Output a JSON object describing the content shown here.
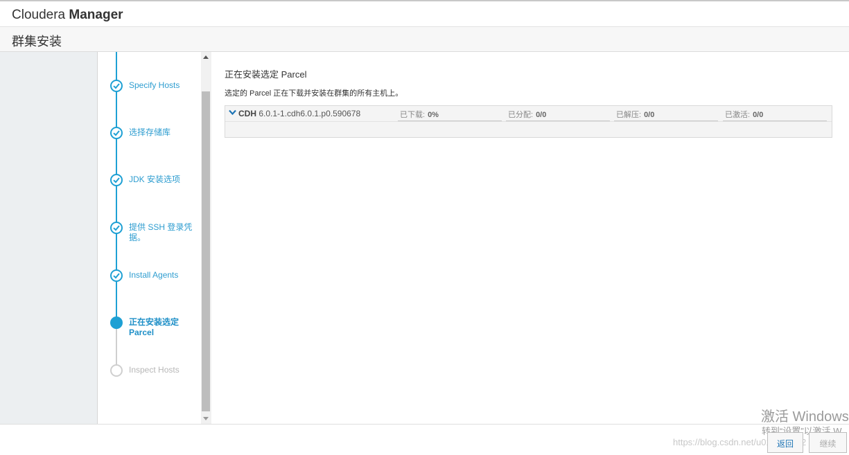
{
  "header": {
    "brand_light": "Cloudera",
    "brand_bold": "Manager"
  },
  "page": {
    "title": "群集安装"
  },
  "steps": [
    {
      "label": "Specify Hosts",
      "state": "done"
    },
    {
      "label": "选择存储库",
      "state": "done"
    },
    {
      "label": "JDK 安装选项",
      "state": "done"
    },
    {
      "label": "提供 SSH 登录凭据。",
      "state": "done"
    },
    {
      "label": "Install Agents",
      "state": "done"
    },
    {
      "label": "正在安装选定 Parcel",
      "state": "current"
    },
    {
      "label": "Inspect Hosts",
      "state": "pending"
    }
  ],
  "main": {
    "heading": "正在安装选定 Parcel",
    "description": "选定的 Parcel 正在下载并安装在群集的所有主机上。",
    "parcel": {
      "name": "CDH",
      "version": "6.0.1-1.cdh6.0.1.p0.590678",
      "stats": [
        {
          "label": "已下载:",
          "value": "0%"
        },
        {
          "label": "已分配:",
          "value": "0/0"
        },
        {
          "label": "已解压:",
          "value": "0/0"
        },
        {
          "label": "已激活:",
          "value": "0/0"
        }
      ]
    }
  },
  "footer": {
    "back_label": "返回",
    "next_label": "继续"
  },
  "watermark": {
    "line1": "激活 Windows",
    "line2": "转到“设置”以激活 W",
    "url": "https://blog.csdn.net/u013012422"
  },
  "colors": {
    "accent": "#1ea0d4",
    "pending": "#cfcfcf"
  }
}
